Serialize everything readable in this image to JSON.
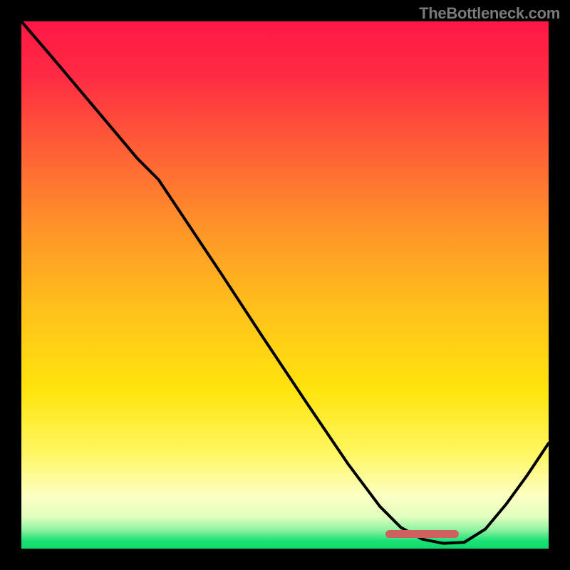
{
  "watermark": "TheBottleneck.com",
  "gradient_stops": [
    {
      "offset": 0.0,
      "color": "#ff1745"
    },
    {
      "offset": 0.1,
      "color": "#ff2a44"
    },
    {
      "offset": 0.25,
      "color": "#ff6235"
    },
    {
      "offset": 0.4,
      "color": "#ff9628"
    },
    {
      "offset": 0.55,
      "color": "#ffc21a"
    },
    {
      "offset": 0.7,
      "color": "#ffe40d"
    },
    {
      "offset": 0.82,
      "color": "#fff763"
    },
    {
      "offset": 0.9,
      "color": "#fcffc3"
    },
    {
      "offset": 0.94,
      "color": "#e1ffbd"
    },
    {
      "offset": 0.965,
      "color": "#8cf2a0"
    },
    {
      "offset": 0.985,
      "color": "#1ae276"
    },
    {
      "offset": 1.0,
      "color": "#10d86c"
    }
  ],
  "marker": {
    "left_frac": 0.69,
    "right_frac": 0.83,
    "y_frac": 0.972
  },
  "chart_data": {
    "type": "line",
    "title": "",
    "xlabel": "",
    "ylabel": "",
    "xlim": [
      0,
      1
    ],
    "ylim": [
      0,
      1
    ],
    "series": [
      {
        "name": "curve",
        "x": [
          0.0,
          0.06,
          0.14,
          0.22,
          0.26,
          0.3,
          0.38,
          0.46,
          0.54,
          0.62,
          0.68,
          0.72,
          0.76,
          0.8,
          0.84,
          0.88,
          0.92,
          0.96,
          1.0
        ],
        "y": [
          1.0,
          0.93,
          0.835,
          0.74,
          0.7,
          0.64,
          0.52,
          0.398,
          0.278,
          0.16,
          0.08,
          0.04,
          0.018,
          0.01,
          0.012,
          0.037,
          0.085,
          0.14,
          0.2
        ]
      }
    ],
    "marker_range_x": [
      0.69,
      0.83
    ],
    "marker_y": 0.028
  }
}
